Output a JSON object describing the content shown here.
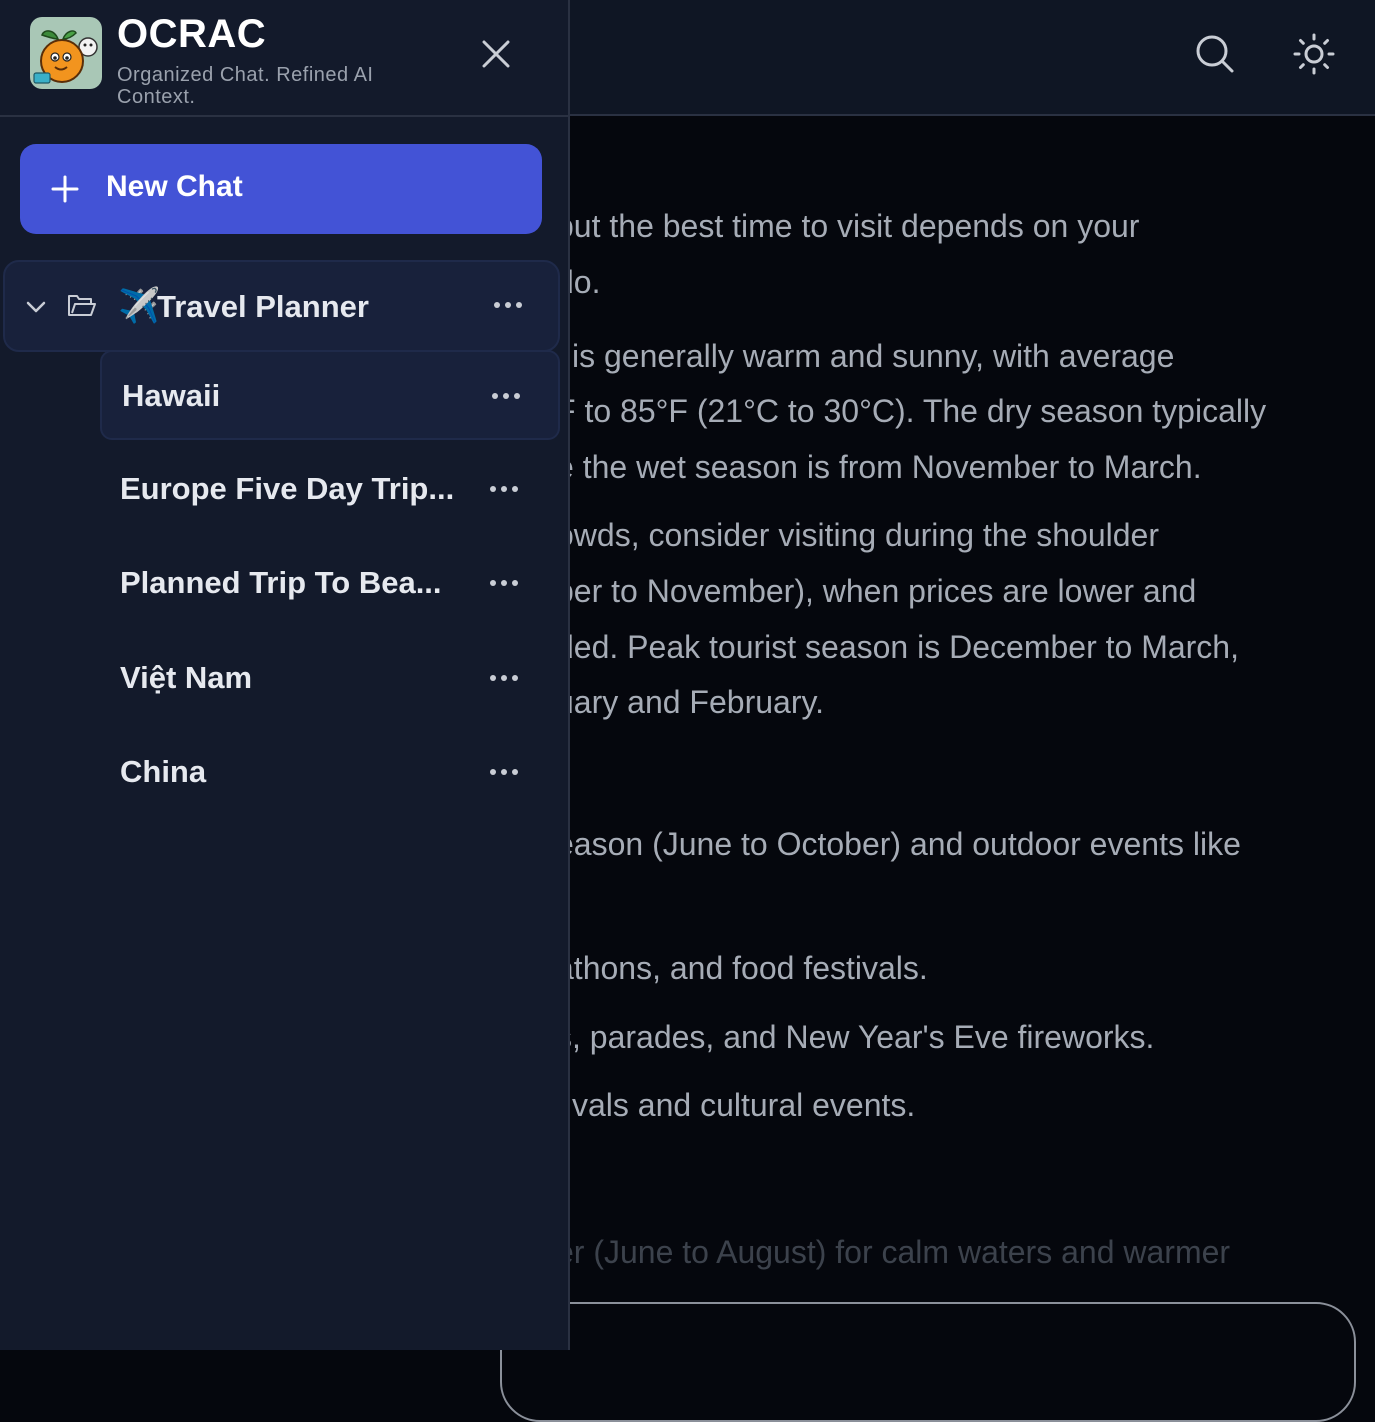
{
  "app": {
    "title": "OCRAC",
    "subtitle": "Organized Chat. Refined AI Context."
  },
  "sidebar": {
    "new_chat_label": "New Chat",
    "folder": {
      "emoji": "✈️",
      "name": "Travel Planner",
      "expanded": true
    },
    "chats": [
      {
        "label": "Hawaii",
        "active": true
      },
      {
        "label": "Europe Five Day Trip...",
        "active": false
      },
      {
        "label": "Planned Trip To Bea...",
        "active": false
      },
      {
        "label": "Việt Nam",
        "active": false
      },
      {
        "label": "China",
        "active": false
      }
    ]
  },
  "topbar": {
    "icons": [
      "search-icon",
      "sun-icon"
    ]
  },
  "content": {
    "lines": [
      {
        "text": "but the best time to visit depends on your"
      },
      {
        "text": "do."
      },
      {
        "text": "i is generally warm and sunny, with average"
      },
      {
        "text": "F to 85°F (21°C to 30°C). The dry season typically"
      },
      {
        "text": "e the wet season is from November to March."
      },
      {
        "text": "owds, consider visiting during the shoulder"
      },
      {
        "text": "ber to November), when prices are lower and"
      },
      {
        "text": "ded. Peak tourist season is December to March,"
      },
      {
        "text": "uary and February."
      },
      {
        "text": "eason (June to October) and outdoor events like"
      },
      {
        "text": "athons, and food festivals."
      },
      {
        "text": "s, parades, and New Year's Eve fireworks."
      },
      {
        "text": "tivals and cultural events."
      },
      {
        "text": "er (June to August) for calm waters and warmer"
      }
    ]
  },
  "colors": {
    "accent": "#4353d6",
    "sidebar_bg": "#131a2b",
    "main_bg": "#05070d"
  }
}
